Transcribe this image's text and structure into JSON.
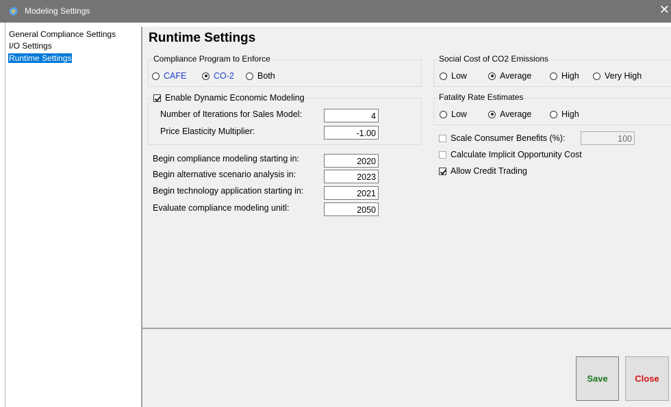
{
  "window": {
    "title": "Modeling Settings",
    "close_glyph": "✕"
  },
  "nav": {
    "items": [
      {
        "label": "General Compliance Settings",
        "selected": false
      },
      {
        "label": "I/O Settings",
        "selected": false
      },
      {
        "label": "Runtime Settings",
        "selected": true
      }
    ]
  },
  "page": {
    "title": "Runtime Settings"
  },
  "compliance_program": {
    "label": "Compliance Program to Enforce",
    "options": [
      {
        "label": "CAFE",
        "checked": false
      },
      {
        "label": "CO-2",
        "checked": true
      },
      {
        "label": "Both",
        "checked": false
      }
    ]
  },
  "dynamic_modeling": {
    "label": "Enable Dynamic Economic Modeling",
    "checked": true,
    "iterations_label": "Number of Iterations for Sales Model:",
    "iterations_value": "4",
    "elasticity_label": "Price Elasticity Multiplier:",
    "elasticity_value": "-1.00"
  },
  "years": {
    "begin_compliance_label": "Begin compliance modeling starting in:",
    "begin_compliance_value": "2020",
    "begin_alternative_label": "Begin alternative scenario analysis in:",
    "begin_alternative_value": "2023",
    "begin_technology_label": "Begin technology application starting in:",
    "begin_technology_value": "2021",
    "evaluate_until_label": "Evaluate compliance modeling unitl:",
    "evaluate_until_value": "2050"
  },
  "social_cost": {
    "label": "Social Cost of CO2 Emissions",
    "options": [
      {
        "label": "Low",
        "checked": false
      },
      {
        "label": "Average",
        "checked": true
      },
      {
        "label": "High",
        "checked": false
      },
      {
        "label": "Very High",
        "checked": false
      }
    ]
  },
  "fatality": {
    "label": "Fatality Rate Estimates",
    "options": [
      {
        "label": "Low",
        "checked": false
      },
      {
        "label": "Average",
        "checked": true
      },
      {
        "label": "High",
        "checked": false
      }
    ]
  },
  "options": {
    "scale_benefits_label": "Scale Consumer Benefits (%):",
    "scale_benefits_checked": false,
    "scale_benefits_value": "100",
    "implicit_cost_label": "Calculate Implicit Opportunity Cost",
    "implicit_cost_checked": false,
    "credit_trading_label": "Allow Credit Trading",
    "credit_trading_checked": true
  },
  "buttons": {
    "save": "Save",
    "close": "Close"
  },
  "colors": {
    "selection": "#0078d7",
    "save_text": "#1a7a1a",
    "close_text": "#d21414",
    "radio_text_blue": "#1f3fd0"
  }
}
